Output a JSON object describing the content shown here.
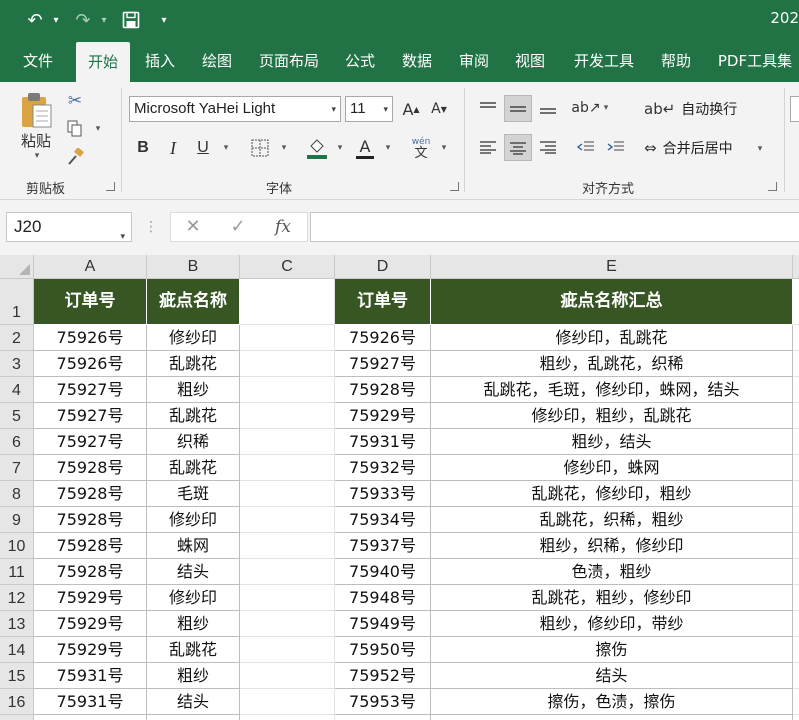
{
  "titlebar": {
    "title": "202"
  },
  "tabs": [
    "文件",
    "开始",
    "插入",
    "绘图",
    "页面布局",
    "公式",
    "数据",
    "审阅",
    "视图",
    "开发工具",
    "帮助",
    "PDF工具集"
  ],
  "ribbon": {
    "clipboard": {
      "paste_label": "粘贴",
      "group_label": "剪贴板"
    },
    "font": {
      "font_name": "Microsoft YaHei Light",
      "font_size": "11",
      "bold": "B",
      "italic": "I",
      "underline": "U",
      "font_color_glyph": "A",
      "phonetic_top": "wén",
      "phonetic_bottom": "文",
      "grow": "A",
      "shrink": "A",
      "group_label": "字体"
    },
    "alignment": {
      "wrap_text": "自动换行",
      "merge_center": "合并后居中",
      "group_label": "对齐方式"
    }
  },
  "formula_bar": {
    "name_box": "J20",
    "fx": "fx",
    "cancel": "✕",
    "enter": "✓",
    "value": ""
  },
  "grid": {
    "columns": [
      "A",
      "B",
      "C",
      "D",
      "E"
    ],
    "row_numbers": [
      "1",
      "2",
      "3",
      "4",
      "5",
      "6",
      "7",
      "8",
      "9",
      "10",
      "11",
      "12",
      "13",
      "14",
      "15",
      "16"
    ],
    "left_table": {
      "headers": [
        "订单号",
        "疵点名称"
      ],
      "rows": [
        [
          "75926号",
          "修纱印"
        ],
        [
          "75926号",
          "乱跳花"
        ],
        [
          "75927号",
          "粗纱"
        ],
        [
          "75927号",
          "乱跳花"
        ],
        [
          "75927号",
          "织稀"
        ],
        [
          "75928号",
          "乱跳花"
        ],
        [
          "75928号",
          "毛斑"
        ],
        [
          "75928号",
          "修纱印"
        ],
        [
          "75928号",
          "蛛网"
        ],
        [
          "75928号",
          "结头"
        ],
        [
          "75929号",
          "修纱印"
        ],
        [
          "75929号",
          "粗纱"
        ],
        [
          "75929号",
          "乱跳花"
        ],
        [
          "75931号",
          "粗纱"
        ],
        [
          "75931号",
          "结头"
        ]
      ]
    },
    "right_table": {
      "headers": [
        "订单号",
        "疵点名称汇总"
      ],
      "rows": [
        [
          "75926号",
          "修纱印，乱跳花"
        ],
        [
          "75927号",
          "粗纱，乱跳花，织稀"
        ],
        [
          "75928号",
          "乱跳花，毛斑，修纱印，蛛网，结头"
        ],
        [
          "75929号",
          "修纱印，粗纱，乱跳花"
        ],
        [
          "75931号",
          "粗纱，结头"
        ],
        [
          "75932号",
          "修纱印，蛛网"
        ],
        [
          "75933号",
          "乱跳花，修纱印，粗纱"
        ],
        [
          "75934号",
          "乱跳花，织稀，粗纱"
        ],
        [
          "75937号",
          "粗纱，织稀，修纱印"
        ],
        [
          "75940号",
          "色渍，粗纱"
        ],
        [
          "75948号",
          "乱跳花，粗纱，修纱印"
        ],
        [
          "75949号",
          "粗纱，修纱印，带纱"
        ],
        [
          "75950号",
          "擦伤"
        ],
        [
          "75952号",
          "结头"
        ],
        [
          "75953号",
          "擦伤，色渍，擦伤"
        ]
      ]
    }
  },
  "colors": {
    "excel_green": "#217346",
    "header_fill": "#375623",
    "ribbon_bg": "#f3f3f3"
  }
}
